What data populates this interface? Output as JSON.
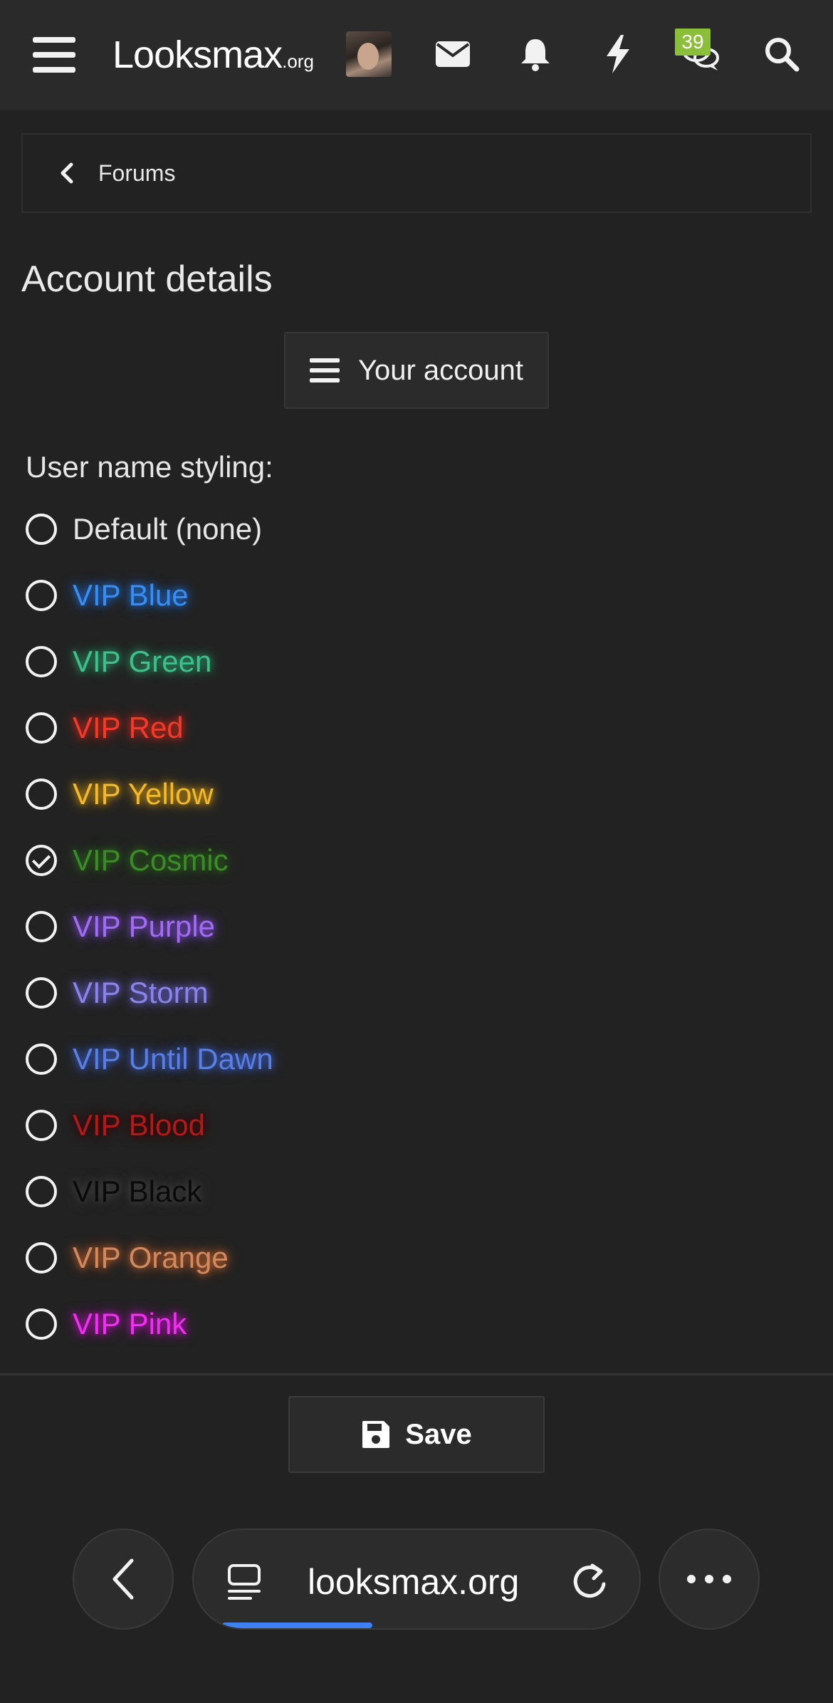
{
  "header": {
    "logo_main": "Looksmax",
    "logo_tld": ".org",
    "conversations_badge": "39"
  },
  "breadcrumb": {
    "label": "Forums"
  },
  "page": {
    "title": "Account details"
  },
  "account_button": {
    "label": "Your account"
  },
  "styling": {
    "label": "User name styling:",
    "options": [
      {
        "label": "Default (none)",
        "color": "#e6e6e6",
        "glow": "none",
        "checked": false
      },
      {
        "label": "VIP Blue",
        "color": "#3a8df0",
        "glow": "#1f6fd6",
        "checked": false
      },
      {
        "label": "VIP Green",
        "color": "#3fbf8a",
        "glow": "#2a9a6a",
        "checked": false
      },
      {
        "label": "VIP Red",
        "color": "#f03a2a",
        "glow": "#c8261a",
        "checked": false
      },
      {
        "label": "VIP Yellow",
        "color": "#f2b92e",
        "glow": "#d49a10",
        "checked": false
      },
      {
        "label": "VIP Cosmic",
        "color": "#3d8a2a",
        "glow": "#2a6a1a",
        "checked": true
      },
      {
        "label": "VIP Purple",
        "color": "#a06cf0",
        "glow": "#7f4ad6",
        "checked": false
      },
      {
        "label": "VIP Storm",
        "color": "#8a84e8",
        "glow": "#6a62d0",
        "checked": false
      },
      {
        "label": "VIP Until Dawn",
        "color": "#5a7fe0",
        "glow": "#3a5fc8",
        "checked": false
      },
      {
        "label": "VIP Blood",
        "color": "#b01a1a",
        "glow": "#3a0505",
        "checked": false
      },
      {
        "label": "VIP Black",
        "color": "#0a0a0a",
        "glow": "#444444",
        "checked": false
      },
      {
        "label": "VIP Orange",
        "color": "#d08a60",
        "glow": "#c0602a",
        "checked": false
      },
      {
        "label": "VIP Pink",
        "color": "#f030f0",
        "glow": "#c010c0",
        "checked": false
      }
    ]
  },
  "save_button": {
    "label": "Save"
  },
  "browser": {
    "url": "looksmax.org",
    "load_progress": 0.34
  }
}
